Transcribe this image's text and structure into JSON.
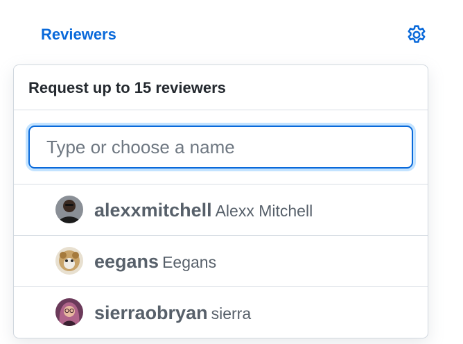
{
  "sidebar": {
    "heading": "Reviewers",
    "gear_icon": "gear-icon"
  },
  "menu": {
    "title": "Request up to 15 reviewers",
    "filter": {
      "placeholder": "Type or choose a name",
      "value": ""
    },
    "users": [
      {
        "login": "alexxmitchell",
        "name": "Alexx Mitchell",
        "avatar": "avatar-photo"
      },
      {
        "login": "eegans",
        "name": "Eegans",
        "avatar": "avatar-cat-photo"
      },
      {
        "login": "sierraobryan",
        "name": "sierra",
        "avatar": "avatar-photo"
      }
    ]
  },
  "colors": {
    "accent": "#0969da",
    "text": "#24292f",
    "muted": "#57606a",
    "border": "#d0d7de"
  }
}
